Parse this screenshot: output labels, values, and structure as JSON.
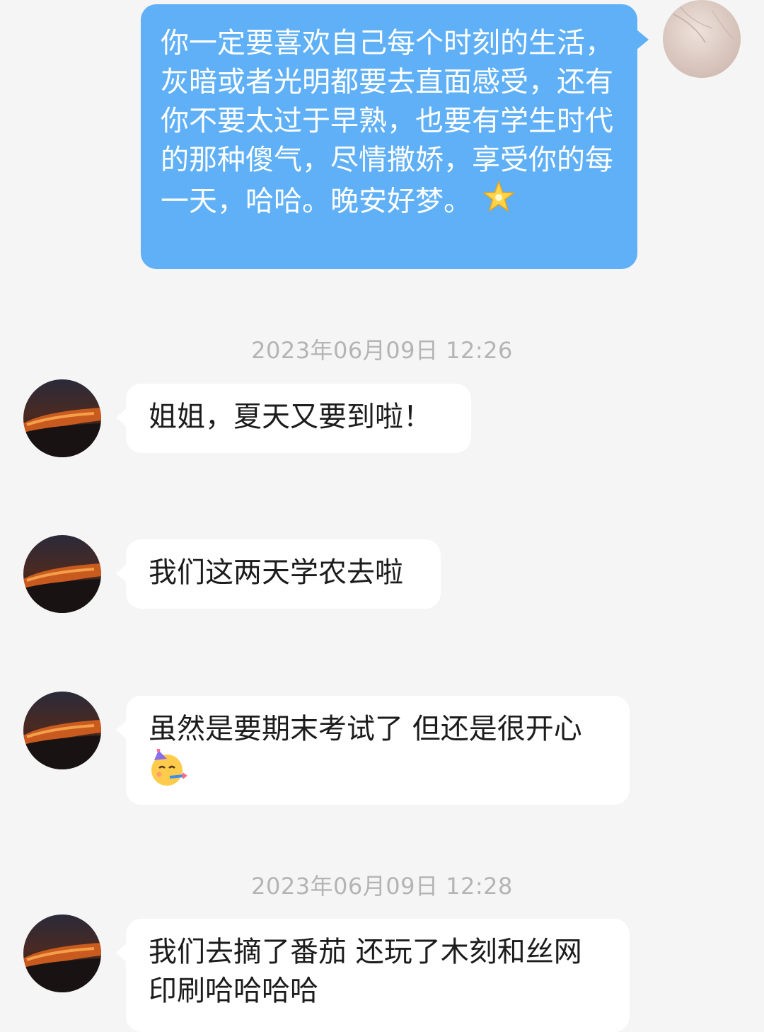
{
  "messages": [
    {
      "direction": "out",
      "text": "你一定要喜欢自己每个时刻的生活，灰暗或者光明都要去直面感受，还有你不要太过于早熟，也要有学生时代的那种傻气，尽情撒娇，享受你的每一天，哈哈。晚安好梦。",
      "emoji": "glowing-star-icon"
    },
    {
      "direction": "in",
      "text": "姐姐，夏天又要到啦！"
    },
    {
      "direction": "in",
      "text": "我们这两天学农去啦"
    },
    {
      "direction": "in",
      "text": "虽然是要期末考试了 但还是很开心",
      "emoji": "partying-face-icon"
    },
    {
      "direction": "in",
      "text": "我们去摘了番茄 还玩了木刻和丝网印刷哈哈哈哈"
    }
  ],
  "timestamps": [
    "2023年06月09日 12:26",
    "2023年06月09日 12:28"
  ],
  "colors": {
    "background": "#f5f5f5",
    "outgoing_bubble": "#5fb0f7",
    "incoming_bubble": "#ffffff",
    "timestamp_text": "#b4b4b4"
  }
}
